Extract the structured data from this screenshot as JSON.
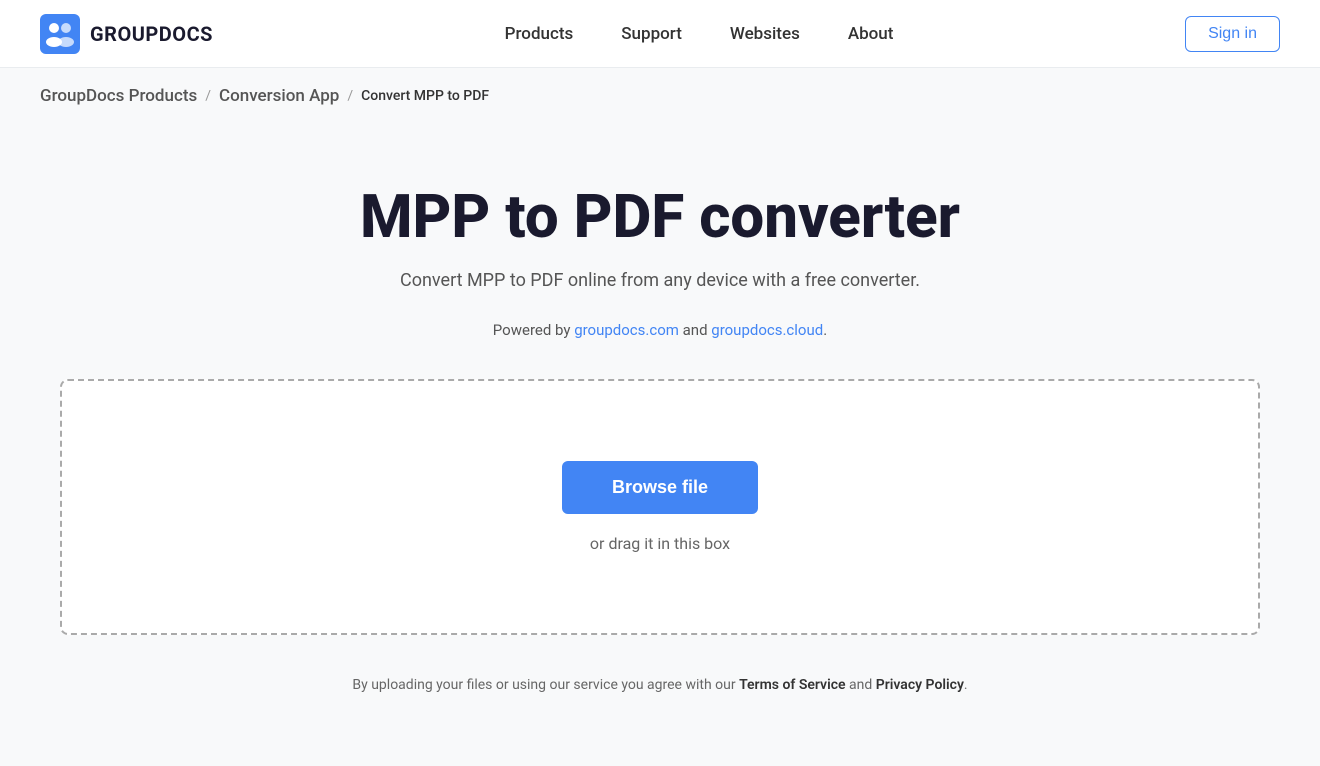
{
  "header": {
    "logo_text": "GROUPDOCS",
    "nav": {
      "products_label": "Products",
      "support_label": "Support",
      "websites_label": "Websites",
      "about_label": "About"
    },
    "sign_in_label": "Sign in"
  },
  "breadcrumb": {
    "root_label": "GroupDocs Products",
    "second_label": "Conversion App",
    "current_label": "Convert MPP to PDF"
  },
  "main": {
    "page_title": "MPP to PDF converter",
    "subtitle": "Convert MPP to PDF online from any device with a free converter.",
    "powered_by_prefix": "Powered by ",
    "powered_by_link1": "groupdocs.com",
    "powered_by_and": " and ",
    "powered_by_link2": "groupdocs.cloud",
    "powered_by_suffix": ".",
    "browse_button_label": "Browse file",
    "drag_text": "or drag it in this box",
    "footer_note_prefix": "By uploading your files or using our service you agree with our ",
    "terms_label": "Terms of Service",
    "footer_note_and": " and ",
    "privacy_label": "Privacy Policy",
    "footer_note_suffix": "."
  },
  "colors": {
    "accent": "#4285f4",
    "text_dark": "#1a1a2e",
    "text_mid": "#555",
    "border_dashed": "#aaa"
  }
}
